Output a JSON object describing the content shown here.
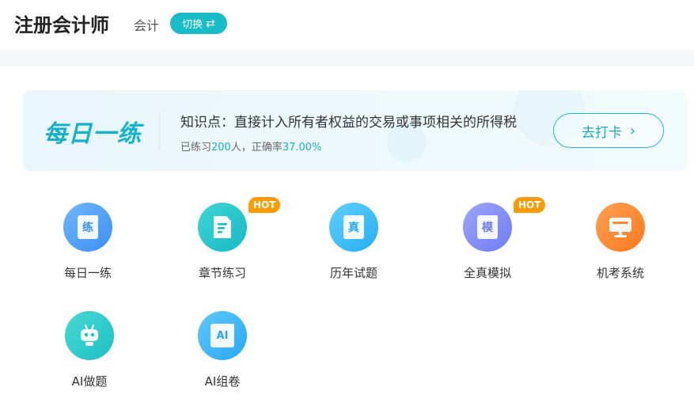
{
  "header": {
    "title": "注册会计师",
    "subject": "会计",
    "switch_label": "切换",
    "switch_icon": "⇄"
  },
  "daily": {
    "logo_text": "每日一练",
    "knowledge": "知识点：直接计入所有者权益的交易或事项相关的所得税",
    "stats_prefix": "已练习",
    "stats_count": "200",
    "stats_mid": "人，正确率",
    "stats_rate": "37.00%",
    "checkin_label": "去打卡",
    "checkin_icon": "›"
  },
  "features": [
    {
      "label": "每日一练",
      "icon_char": "练",
      "hot": ""
    },
    {
      "label": "章节练习",
      "icon_char": "",
      "hot": "HOT"
    },
    {
      "label": "历年试题",
      "icon_char": "真",
      "hot": ""
    },
    {
      "label": "全真模拟",
      "icon_char": "模",
      "hot": "HOT"
    },
    {
      "label": "机考系统",
      "icon_char": "",
      "hot": ""
    },
    {
      "label": "AI做题",
      "icon_char": "",
      "hot": ""
    },
    {
      "label": "AI组卷",
      "icon_char": "AI",
      "hot": ""
    }
  ],
  "colors": {
    "accent": "#18bcc6",
    "hot": "#ff9a00"
  }
}
